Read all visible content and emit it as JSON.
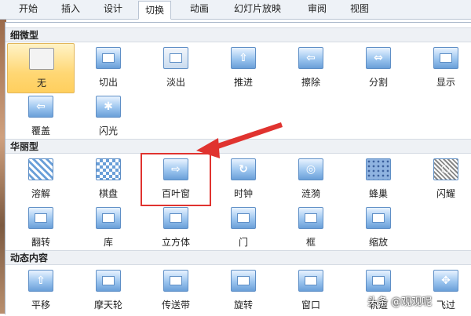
{
  "tabs": [
    "开始",
    "插入",
    "设计",
    "切换",
    "动画",
    "幻灯片放映",
    "审阅",
    "视图"
  ],
  "active_tab": "切换",
  "sections": [
    {
      "title": "细微型",
      "items": [
        "无",
        "切出",
        "淡出",
        "推进",
        "擦除",
        "分割",
        "显示",
        "覆盖",
        "闪光"
      ]
    },
    {
      "title": "华丽型",
      "items": [
        "溶解",
        "棋盘",
        "百叶窗",
        "时钟",
        "涟漪",
        "蜂巢",
        "闪耀",
        "翻转",
        "库",
        "立方体",
        "门",
        "框",
        "缩放"
      ]
    },
    {
      "title": "动态内容",
      "items": [
        "平移",
        "摩天轮",
        "传送带",
        "旋转",
        "窗口",
        "轨道",
        "飞过"
      ]
    }
  ],
  "selected_item": "无",
  "highlighted_item": "百叶窗",
  "watermark": "头条 @观观呢",
  "colors": {
    "accent_red": "#e0332f",
    "selected_bg": "#ffd774"
  }
}
